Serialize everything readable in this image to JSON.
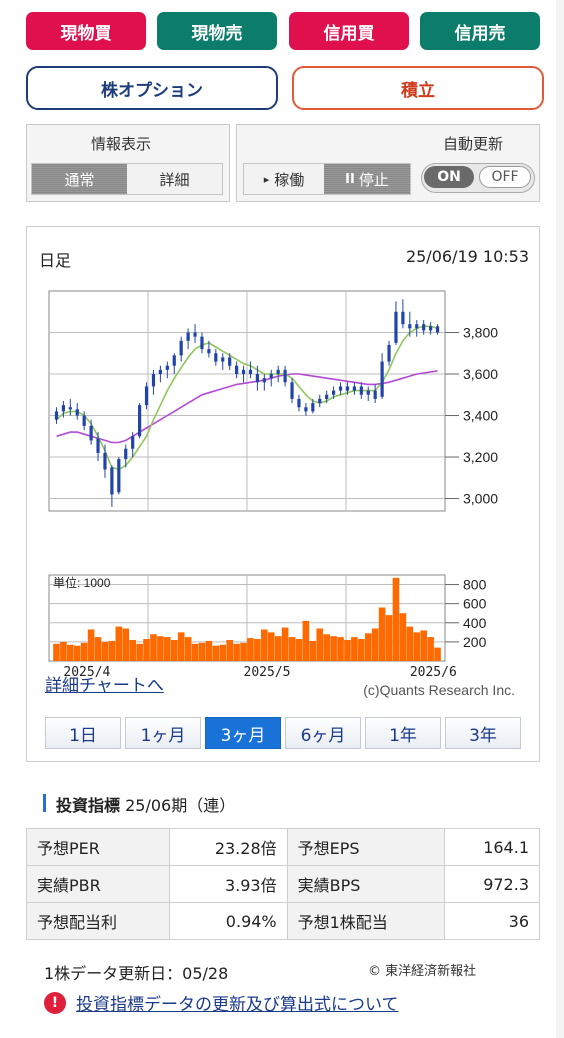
{
  "trade_buttons": {
    "genbutsu_buy": "現物買",
    "genbutsu_sell": "現物売",
    "shinyo_buy": "信用買",
    "shinyo_sell": "信用売"
  },
  "wide_buttons": {
    "stock_option": "株オプション",
    "tsumitate": "積立"
  },
  "info_display": {
    "title": "情報表示",
    "normal": "通常",
    "detail": "詳細"
  },
  "run_control": {
    "run": "稼働",
    "run_glyph": "▸",
    "stop": "停止",
    "stop_glyph": "II"
  },
  "auto_update": {
    "title": "自動更新",
    "on": "ON",
    "off": "OFF"
  },
  "chart_card": {
    "period_label": "日足",
    "datetime": "25/06/19 10:53",
    "detail_link": "詳細チャートへ",
    "credit": "(c)Quants Research Inc.",
    "periods": [
      "1日",
      "1ヶ月",
      "3ヶ月",
      "6ヶ月",
      "1年",
      "3年"
    ],
    "active_period": "3ヶ月"
  },
  "chart_data": {
    "type": "candlestick",
    "price_ticks": [
      "3,800",
      "3,600",
      "3,400",
      "3,200",
      "3,000"
    ],
    "price_tick_values": [
      3800,
      3600,
      3400,
      3200,
      3000
    ],
    "price_range": [
      2940,
      4000
    ],
    "volume_unit_label": "単位: 1000",
    "volume_ticks": [
      "800",
      "600",
      "400",
      "200"
    ],
    "volume_tick_values": [
      800,
      600,
      400,
      200
    ],
    "volume_range": [
      0,
      900
    ],
    "x_labels": [
      "2025/4",
      "2025/5",
      "2025/6"
    ],
    "x_label_indices": [
      1,
      27,
      51
    ],
    "colors": {
      "candle": "#2244aa",
      "ma_short": "#8fc65a",
      "ma_long": "#b44ad6",
      "volume": "#ff6a00",
      "grid": "#bdbdbd"
    },
    "ohlc": [
      [
        3380,
        3440,
        3360,
        3420
      ],
      [
        3420,
        3470,
        3390,
        3450
      ],
      [
        3440,
        3480,
        3400,
        3430
      ],
      [
        3430,
        3460,
        3380,
        3400
      ],
      [
        3400,
        3420,
        3330,
        3350
      ],
      [
        3350,
        3380,
        3260,
        3280
      ],
      [
        3290,
        3320,
        3180,
        3220
      ],
      [
        3220,
        3260,
        3100,
        3140
      ],
      [
        3150,
        3160,
        2960,
        3020
      ],
      [
        3030,
        3200,
        3020,
        3190
      ],
      [
        3190,
        3260,
        3150,
        3240
      ],
      [
        3240,
        3320,
        3200,
        3300
      ],
      [
        3300,
        3460,
        3290,
        3450
      ],
      [
        3450,
        3560,
        3430,
        3540
      ],
      [
        3540,
        3620,
        3500,
        3600
      ],
      [
        3600,
        3640,
        3560,
        3620
      ],
      [
        3620,
        3660,
        3580,
        3640
      ],
      [
        3640,
        3700,
        3600,
        3690
      ],
      [
        3690,
        3780,
        3660,
        3760
      ],
      [
        3760,
        3820,
        3720,
        3800
      ],
      [
        3800,
        3840,
        3750,
        3780
      ],
      [
        3780,
        3800,
        3700,
        3720
      ],
      [
        3720,
        3760,
        3680,
        3700
      ],
      [
        3700,
        3720,
        3640,
        3660
      ],
      [
        3660,
        3700,
        3620,
        3680
      ],
      [
        3680,
        3700,
        3620,
        3640
      ],
      [
        3640,
        3660,
        3580,
        3600
      ],
      [
        3600,
        3640,
        3560,
        3620
      ],
      [
        3620,
        3660,
        3580,
        3600
      ],
      [
        3600,
        3640,
        3520,
        3560
      ],
      [
        3560,
        3600,
        3520,
        3580
      ],
      [
        3580,
        3620,
        3540,
        3600
      ],
      [
        3600,
        3640,
        3560,
        3620
      ],
      [
        3620,
        3640,
        3540,
        3560
      ],
      [
        3560,
        3580,
        3460,
        3480
      ],
      [
        3480,
        3500,
        3420,
        3440
      ],
      [
        3440,
        3460,
        3400,
        3420
      ],
      [
        3420,
        3480,
        3410,
        3460
      ],
      [
        3460,
        3500,
        3440,
        3480
      ],
      [
        3480,
        3520,
        3460,
        3500
      ],
      [
        3500,
        3540,
        3480,
        3520
      ],
      [
        3520,
        3560,
        3500,
        3540
      ],
      [
        3540,
        3560,
        3500,
        3520
      ],
      [
        3520,
        3560,
        3500,
        3540
      ],
      [
        3540,
        3560,
        3480,
        3500
      ],
      [
        3500,
        3540,
        3470,
        3520
      ],
      [
        3520,
        3550,
        3460,
        3480
      ],
      [
        3490,
        3700,
        3480,
        3660
      ],
      [
        3660,
        3760,
        3640,
        3740
      ],
      [
        3750,
        3950,
        3740,
        3900
      ],
      [
        3900,
        3960,
        3820,
        3840
      ],
      [
        3840,
        3900,
        3780,
        3820
      ],
      [
        3820,
        3860,
        3780,
        3840
      ],
      [
        3840,
        3860,
        3790,
        3810
      ],
      [
        3810,
        3850,
        3790,
        3830
      ],
      [
        3830,
        3840,
        3790,
        3800
      ]
    ],
    "volume": [
      180,
      200,
      170,
      160,
      190,
      330,
      250,
      200,
      210,
      360,
      340,
      220,
      180,
      230,
      280,
      260,
      250,
      220,
      300,
      250,
      180,
      190,
      210,
      160,
      170,
      220,
      180,
      190,
      240,
      230,
      330,
      300,
      260,
      350,
      250,
      230,
      420,
      210,
      340,
      280,
      260,
      250,
      220,
      250,
      230,
      290,
      340,
      560,
      480,
      870,
      500,
      360,
      300,
      320,
      250,
      140
    ],
    "ma_short": [
      3380,
      3410,
      3420,
      3420,
      3400,
      3360,
      3300,
      3230,
      3150,
      3140,
      3160,
      3200,
      3250,
      3300,
      3380,
      3450,
      3520,
      3580,
      3630,
      3680,
      3720,
      3740,
      3750,
      3730,
      3710,
      3690,
      3670,
      3650,
      3640,
      3620,
      3600,
      3600,
      3600,
      3600,
      3580,
      3540,
      3500,
      3470,
      3460,
      3470,
      3490,
      3500,
      3510,
      3520,
      3520,
      3520,
      3520,
      3560,
      3620,
      3700,
      3760,
      3800,
      3820,
      3830,
      3830,
      3820
    ],
    "ma_long": [
      3300,
      3310,
      3320,
      3320,
      3310,
      3300,
      3290,
      3280,
      3270,
      3270,
      3280,
      3300,
      3320,
      3340,
      3360,
      3380,
      3400,
      3420,
      3440,
      3460,
      3480,
      3500,
      3510,
      3520,
      3530,
      3540,
      3550,
      3555,
      3560,
      3565,
      3570,
      3580,
      3590,
      3595,
      3600,
      3600,
      3595,
      3590,
      3585,
      3580,
      3575,
      3570,
      3565,
      3560,
      3555,
      3550,
      3550,
      3555,
      3560,
      3570,
      3580,
      3590,
      3600,
      3605,
      3610,
      3615
    ]
  },
  "indicators": {
    "title": "投資指標",
    "subtitle": " 25/06期（連）",
    "rows": [
      {
        "k1": "予想PER",
        "v1": "23.28倍",
        "k2": "予想EPS",
        "v2": "164.1"
      },
      {
        "k1": "実績PBR",
        "v1": "3.93倍",
        "k2": "実績BPS",
        "v2": "972.3"
      },
      {
        "k1": "予想配当利",
        "v1": "0.94%",
        "k2": "予想1株配当",
        "v2": "36"
      }
    ],
    "updated": "1株データ更新日：05/28",
    "source": "© 東洋経済新報社",
    "notice_icon": "!",
    "notice_link": "投資指標データの更新及び算出式について"
  }
}
